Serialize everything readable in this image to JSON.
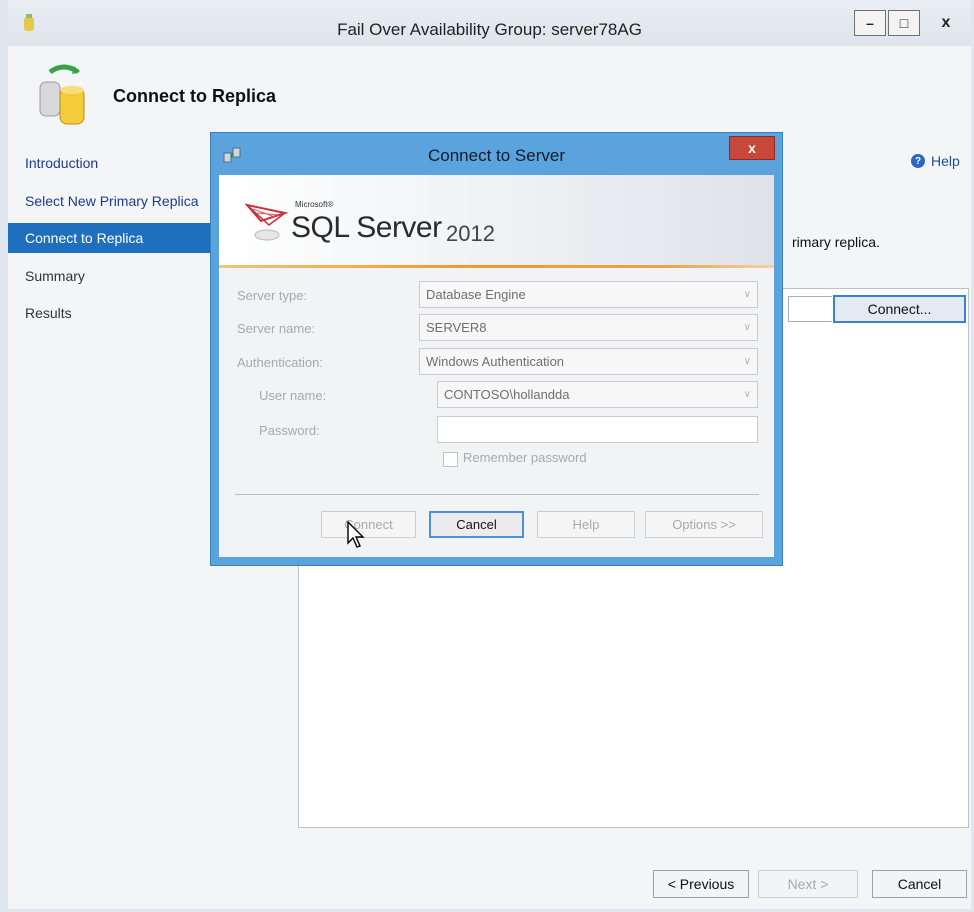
{
  "window": {
    "title": "Fail Over Availability Group: server78AG",
    "controls": {
      "minimize": "–",
      "maximize": "□",
      "close": "x"
    }
  },
  "page": {
    "title": "Connect to Replica",
    "help_label": "Help",
    "instruction": "rimary replica.",
    "connect_button": "Connect..."
  },
  "nav": {
    "items": [
      {
        "label": "Introduction",
        "state": "link"
      },
      {
        "label": "Select New Primary Replica",
        "state": "link"
      },
      {
        "label": "Connect to Replica",
        "state": "active"
      },
      {
        "label": "Summary",
        "state": "plain"
      },
      {
        "label": "Results",
        "state": "plain"
      }
    ]
  },
  "footer": {
    "previous": "< Previous",
    "next": "Next >",
    "cancel": "Cancel"
  },
  "dialog": {
    "title": "Connect to Server",
    "close_label": "x",
    "banner": {
      "microsoft": "Microsoft®",
      "product": "SQL Server",
      "version": "2012"
    },
    "fields": {
      "server_type": {
        "label": "Server type:",
        "value": "Database Engine"
      },
      "server_name": {
        "label": "Server name:",
        "value": "SERVER8"
      },
      "authentication": {
        "label": "Authentication:",
        "value": "Windows Authentication"
      },
      "user_name": {
        "label": "User name:",
        "value": "CONTOSO\\hollandda"
      },
      "password": {
        "label": "Password:",
        "value": ""
      }
    },
    "remember_password": "Remember password",
    "buttons": {
      "connect": "Connect",
      "cancel": "Cancel",
      "help": "Help",
      "options": "Options >>"
    }
  },
  "colors": {
    "accent": "#1f6fbf",
    "dialog_frame": "#5ba3dc",
    "close_red": "#c8473b",
    "banner_orange": "#ef9b2a"
  }
}
